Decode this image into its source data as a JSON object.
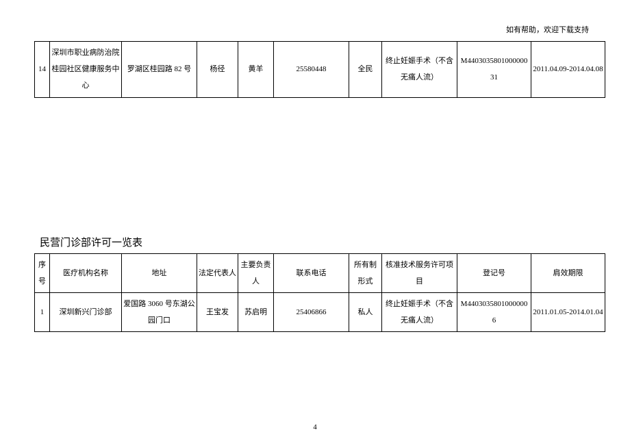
{
  "header_note": "如有帮助，欢迎下载支持",
  "page_number": "4",
  "top_row": {
    "idx": "14",
    "name": "深圳市职业病防治院桂园社区健康服务中心",
    "addr": "罗湖区桂园路 82 号",
    "legal": "杨径",
    "head": "黄羊",
    "phone": "25580448",
    "type": "全民",
    "items": "终止妊娠手术（不含无痛人流）",
    "reg": "M440303580100000031",
    "valid": "2011.04.09-2014.04.08"
  },
  "section_title": "民营门诊部许可一览表",
  "headers": {
    "idx": "序号",
    "name": "医疗机构名称",
    "addr": "地址",
    "legal": "法定代表人",
    "head": "主要负责人",
    "phone": "联系电话",
    "type": "所有制形式",
    "items": "核准技术服务许可项目",
    "reg": "登记号",
    "valid": "肩效期限"
  },
  "rows": [
    {
      "idx": "1",
      "name": "深圳新兴门诊部",
      "addr": "爱国路 3060 号东湖公园门口",
      "legal": "王宝发",
      "head": "苏启明",
      "phone": "25406866",
      "type": "私人",
      "items": "终止妊娠手术（不含无痛人流）",
      "reg": "M44030358010000006",
      "valid": "2011.01.05-2014.01.04"
    }
  ]
}
